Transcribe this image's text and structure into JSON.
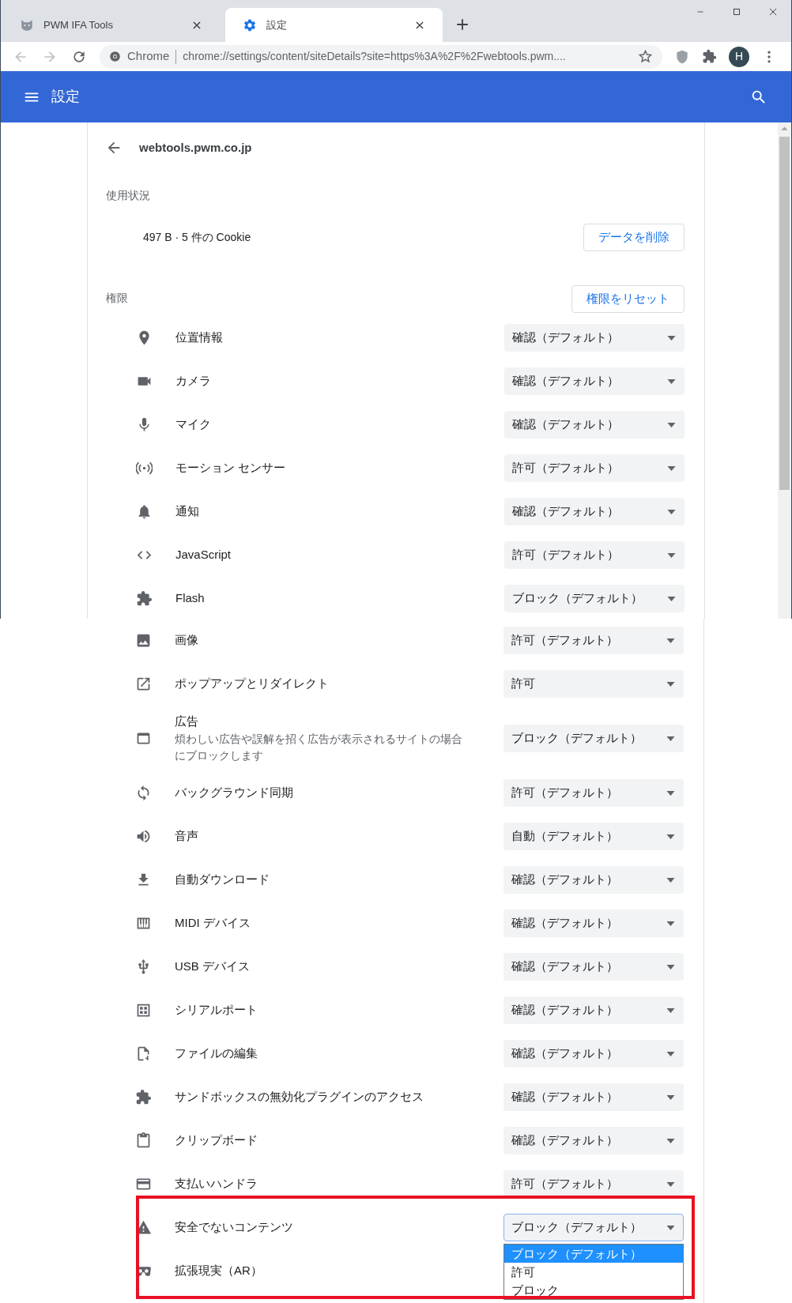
{
  "browser": {
    "tabs": [
      {
        "title": "PWM IFA Tools",
        "kind": "cat",
        "selected": false
      },
      {
        "title": "設定",
        "kind": "gear",
        "selected": true
      }
    ],
    "omnibox": {
      "origin": "Chrome",
      "url": "chrome://settings/content/siteDetails?site=https%3A%2F%2Fwebtools.pwm...."
    },
    "avatar": "H"
  },
  "header": {
    "title": "設定"
  },
  "site": {
    "title": "webtools.pwm.co.jp"
  },
  "usage": {
    "heading": "使用状況",
    "summary": "497 B · 5 件の Cookie",
    "clear_button": "データを削除"
  },
  "permissions": {
    "heading": "権限",
    "reset_button": "権限をリセット",
    "rows": [
      {
        "kind": "location",
        "label": "位置情報",
        "value": "確認（デフォルト）"
      },
      {
        "kind": "camera",
        "label": "カメラ",
        "value": "確認（デフォルト）"
      },
      {
        "kind": "mic",
        "label": "マイク",
        "value": "確認（デフォルト）"
      },
      {
        "kind": "sensors",
        "label": "モーション センサー",
        "value": "許可（デフォルト）"
      },
      {
        "kind": "bell",
        "label": "通知",
        "value": "確認（デフォルト）"
      },
      {
        "kind": "code",
        "label": "JavaScript",
        "value": "許可（デフォルト）"
      },
      {
        "kind": "puzzle",
        "label": "Flash",
        "value": "ブロック（デフォルト）"
      },
      {
        "kind": "image",
        "label": "画像",
        "value": "許可（デフォルト）"
      },
      {
        "kind": "external",
        "label": "ポップアップとリダイレクト",
        "value": "許可"
      },
      {
        "kind": "window",
        "label": "広告",
        "description": "煩わしい広告や誤解を招く広告が表示されるサイトの場合にブロックします",
        "value": "ブロック（デフォルト）"
      },
      {
        "kind": "sync",
        "label": "バックグラウンド同期",
        "value": "許可（デフォルト）"
      },
      {
        "kind": "speaker",
        "label": "音声",
        "value": "自動（デフォルト）"
      },
      {
        "kind": "download",
        "label": "自動ダウンロード",
        "value": "確認（デフォルト）"
      },
      {
        "kind": "piano",
        "label": "MIDI デバイス",
        "value": "確認（デフォルト）"
      },
      {
        "kind": "usb",
        "label": "USB デバイス",
        "value": "確認（デフォルト）"
      },
      {
        "kind": "grid",
        "label": "シリアルポート",
        "value": "確認（デフォルト）"
      },
      {
        "kind": "file",
        "label": "ファイルの編集",
        "value": "確認（デフォルト）"
      },
      {
        "kind": "puzzle",
        "label": "サンドボックスの無効化プラグインのアクセス",
        "value": "確認（デフォルト）"
      },
      {
        "kind": "clipboard",
        "label": "クリップボード",
        "value": "確認（デフォルト）"
      },
      {
        "kind": "card",
        "label": "支払いハンドラ",
        "value": "許可（デフォルト）"
      },
      {
        "kind": "warning",
        "label": "安全でないコンテンツ",
        "value": "ブロック（デフォルト）",
        "expanded": true,
        "options": [
          {
            "label": "ブロック（デフォルト）",
            "selected": true
          },
          {
            "label": "許可",
            "selected": false
          },
          {
            "label": "ブロック",
            "selected": false
          }
        ]
      },
      {
        "kind": "goggles",
        "label": "拡張現実（AR）"
      }
    ]
  },
  "annotation": {
    "kind": "highlight-frame"
  }
}
